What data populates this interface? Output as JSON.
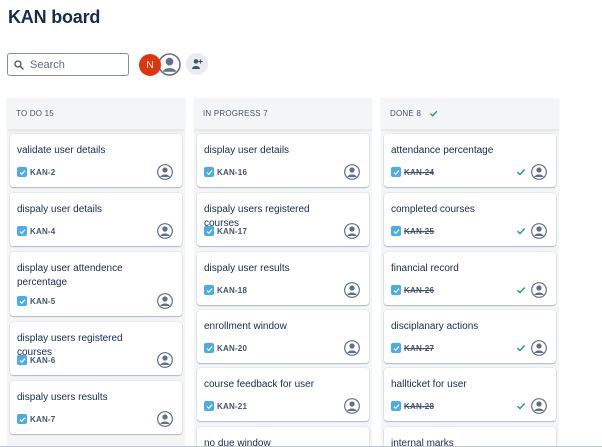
{
  "board": {
    "title": "KAN board"
  },
  "search": {
    "placeholder": "Search",
    "icon": "search-icon"
  },
  "people": {
    "current_user_initial": "N",
    "current_user_color": "#de350b",
    "other_user_icon": "user-avatar-icon",
    "add_people_icon": "add-people-icon"
  },
  "colors": {
    "story": "#4bade8",
    "done": "#22a06b"
  },
  "columns": [
    {
      "label": "TO DO 15",
      "cards": [
        {
          "title": "validate user details",
          "key": "KAN-2"
        },
        {
          "title": "dispaly user details",
          "key": "KAN-4"
        },
        {
          "title": "display user attendence percentage",
          "key": "KAN-5"
        },
        {
          "title": "display users registered courses",
          "key": "KAN-6"
        },
        {
          "title": "dispaly users results",
          "key": "KAN-7"
        }
      ]
    },
    {
      "label": "IN PROGRESS 7",
      "cards": [
        {
          "title": "display user details",
          "key": "KAN-16"
        },
        {
          "title": "dispaly users registered courses",
          "key": "KAN-17"
        },
        {
          "title": "dispaly user results",
          "key": "KAN-18"
        },
        {
          "title": "enrollment window",
          "key": "KAN-20"
        },
        {
          "title": "course feedback for user",
          "key": "KAN-21"
        },
        {
          "title": "no due window",
          "key": ""
        }
      ]
    },
    {
      "label": "DONE 8",
      "cards": [
        {
          "title": "attendance percentage",
          "key": "KAN-24"
        },
        {
          "title": "completed courses",
          "key": "KAN-25"
        },
        {
          "title": "financial record",
          "key": "KAN-26"
        },
        {
          "title": "disciplanary actions",
          "key": "KAN-27"
        },
        {
          "title": "hallticket for user",
          "key": "KAN-28"
        },
        {
          "title": "internal marks",
          "key": ""
        }
      ]
    }
  ]
}
